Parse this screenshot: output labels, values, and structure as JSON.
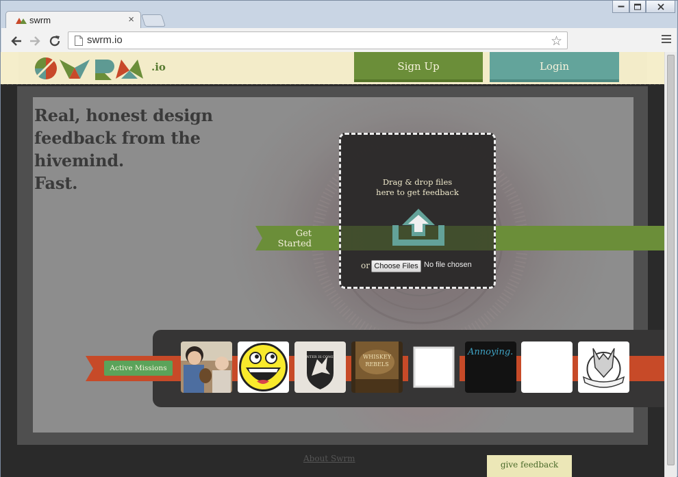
{
  "browser": {
    "tab_title": "swrm",
    "tab_close": "×",
    "url": "swrm.io",
    "star_glyph": "☆"
  },
  "site": {
    "logo_suffix": ".io",
    "signup_label": "Sign Up",
    "login_label": "Login",
    "colors": {
      "green": "#6b8e39",
      "teal": "#63a49b",
      "cream": "#f5eecb",
      "red": "#c74a28"
    }
  },
  "hero": {
    "headline": [
      "Real, honest design",
      "feedback from the",
      "hivemind.",
      "Fast."
    ],
    "get_started": "Get Started",
    "dropzone_text": [
      "Drag & drop files",
      "here to get feedback"
    ],
    "or_label": "or",
    "choose_files_label": "Choose Files",
    "no_file_label": "No file chosen"
  },
  "missions": {
    "button_label": "Active Missions",
    "thumbnails": [
      {
        "name": "kids-photo-thumb",
        "kind": "photo"
      },
      {
        "name": "awesome-face-thumb",
        "kind": "smiley"
      },
      {
        "name": "winter-is-coming-thumb",
        "kind": "direwolf",
        "text": "WINTER IS COMING"
      },
      {
        "name": "whiskey-rebels-thumb",
        "kind": "book",
        "text": "WHISKEY REBELS"
      },
      {
        "name": "blank-glow-thumb",
        "kind": "blank-glow"
      },
      {
        "name": "annoying-thumb",
        "kind": "annoying",
        "text": "Annoying."
      },
      {
        "name": "blank-white-thumb",
        "kind": "blank"
      },
      {
        "name": "wolf-crest-thumb",
        "kind": "wolf"
      }
    ]
  },
  "footer": {
    "about_label": "About Swrm",
    "feedback_label": "give feedback"
  }
}
